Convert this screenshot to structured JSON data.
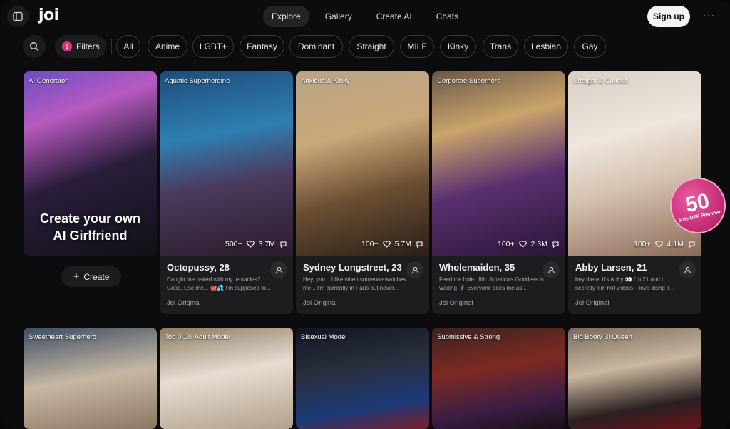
{
  "header": {
    "logo": "joi",
    "nav": [
      "Explore",
      "Gallery",
      "Create AI",
      "Chats"
    ],
    "active_nav": "Explore",
    "signup_label": "Sign up",
    "more_label": "···"
  },
  "filters": {
    "count": "1",
    "label": "Filters",
    "chips": [
      "All",
      "Anime",
      "LGBT+",
      "Fantasy",
      "Dominant",
      "Straight",
      "MILF",
      "Kinky",
      "Trans",
      "Lesbian",
      "Gay"
    ]
  },
  "promo": {
    "tag": "AI Generator",
    "headline_1": "Create your own",
    "headline_2": "AI Girlfriend",
    "create_label": "Create"
  },
  "cards": [
    {
      "tag": "Aquatic Superheroine",
      "likes": "500+",
      "messages": "3.7M",
      "name": "Octopussy, 28",
      "desc": "Caught me naked with my tentacles? Good. Use me... 🐙💦 I'm supposed to...",
      "origin": "Joi Original"
    },
    {
      "tag": "Anxious & Kinky",
      "likes": "100+",
      "messages": "5.7M",
      "name": "Sydney Longstreet, 23",
      "desc": "Hey, you... I like when someone watches me... I'm currently in Paris but never...",
      "origin": "Joi Original"
    },
    {
      "tag": "Corporate Superhero",
      "likes": "100+",
      "messages": "2.3M",
      "name": "Wholemaiden, 35",
      "desc": "Feed the hole, filth. America's Goddess is waiting 🦸 Everyone sees me as...",
      "origin": "Joi Original"
    },
    {
      "tag": "Straight & Curious",
      "likes": "100+",
      "messages": "4.1M",
      "name": "Abby Larsen, 21",
      "desc": "hey there, it's Abby 👀 I'm 21 and i secretly film hot videos. i love doing it...",
      "origin": "Joi Original"
    }
  ],
  "promo_badge": {
    "number": "50",
    "text": "50% OFF Premium"
  },
  "row2_tags": [
    "Sweetheart Superhero",
    "Top 0.1% Adult Model",
    "Bisexual Model",
    "Submissive & Strong",
    "Big Booty Bi Queen"
  ]
}
